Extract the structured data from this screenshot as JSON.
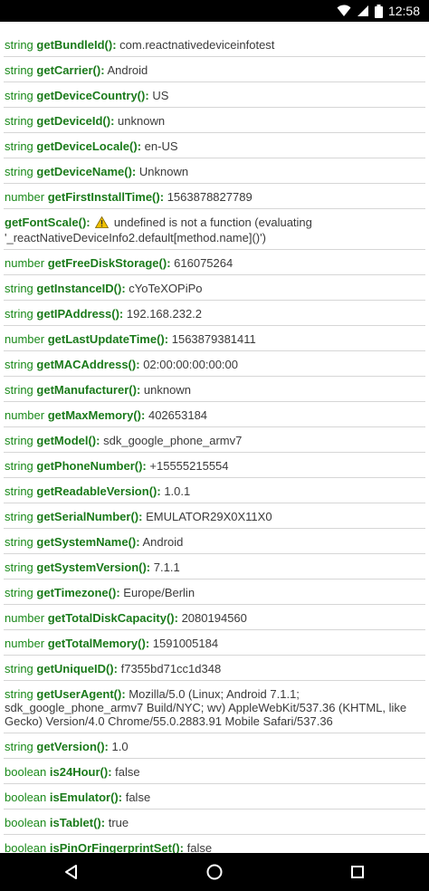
{
  "status_bar": {
    "time": "12:58",
    "icons": [
      "wifi-icon",
      "signal-icon",
      "battery-icon"
    ]
  },
  "rows": [
    {
      "type": "string",
      "method": "getBundleId()",
      "value": "com.reactnativedeviceinfotest"
    },
    {
      "type": "string",
      "method": "getCarrier()",
      "value": "Android"
    },
    {
      "type": "string",
      "method": "getDeviceCountry()",
      "value": "US"
    },
    {
      "type": "string",
      "method": "getDeviceId()",
      "value": "unknown"
    },
    {
      "type": "string",
      "method": "getDeviceLocale()",
      "value": "en-US"
    },
    {
      "type": "string",
      "method": "getDeviceName()",
      "value": "Unknown"
    },
    {
      "type": "number",
      "method": "getFirstInstallTime()",
      "value": "1563878827789"
    },
    {
      "type": "",
      "method": "getFontScale()",
      "warning": true,
      "value": "undefined is not a function (evaluating '_reactNativeDeviceInfo2.default[method.name]()')"
    },
    {
      "type": "number",
      "method": "getFreeDiskStorage()",
      "value": "616075264"
    },
    {
      "type": "string",
      "method": "getInstanceID()",
      "value": "cYoTeXOPiPo"
    },
    {
      "type": "string",
      "method": "getIPAddress()",
      "value": "192.168.232.2"
    },
    {
      "type": "number",
      "method": "getLastUpdateTime()",
      "value": "1563879381411"
    },
    {
      "type": "string",
      "method": "getMACAddress()",
      "value": "02:00:00:00:00:00"
    },
    {
      "type": "string",
      "method": "getManufacturer()",
      "value": "unknown"
    },
    {
      "type": "number",
      "method": "getMaxMemory()",
      "value": "402653184"
    },
    {
      "type": "string",
      "method": "getModel()",
      "value": "sdk_google_phone_armv7"
    },
    {
      "type": "string",
      "method": "getPhoneNumber()",
      "value": "+15555215554"
    },
    {
      "type": "string",
      "method": "getReadableVersion()",
      "value": "1.0.1"
    },
    {
      "type": "string",
      "method": "getSerialNumber()",
      "value": "EMULATOR29X0X11X0"
    },
    {
      "type": "string",
      "method": "getSystemName()",
      "value": "Android"
    },
    {
      "type": "string",
      "method": "getSystemVersion()",
      "value": "7.1.1"
    },
    {
      "type": "string",
      "method": "getTimezone()",
      "value": "Europe/Berlin"
    },
    {
      "type": "number",
      "method": "getTotalDiskCapacity()",
      "value": "2080194560"
    },
    {
      "type": "number",
      "method": "getTotalMemory()",
      "value": "1591005184"
    },
    {
      "type": "string",
      "method": "getUniqueID()",
      "value": "f7355bd71cc1d348"
    },
    {
      "type": "string",
      "method": "getUserAgent()",
      "value": "Mozilla/5.0 (Linux; Android 7.1.1; sdk_google_phone_armv7 Build/NYC; wv) AppleWebKit/537.36 (KHTML, like Gecko) Version/4.0 Chrome/55.0.2883.91 Mobile Safari/537.36"
    },
    {
      "type": "string",
      "method": "getVersion()",
      "value": "1.0"
    },
    {
      "type": "boolean",
      "method": "is24Hour()",
      "value": "false"
    },
    {
      "type": "boolean",
      "method": "isEmulator()",
      "value": "false"
    },
    {
      "type": "boolean",
      "method": "isTablet()",
      "value": "true"
    },
    {
      "type": "boolean",
      "method": "isPinOrFingerprintSet()",
      "value": "false"
    }
  ],
  "nav_bar": {
    "buttons": [
      "back-icon",
      "home-icon",
      "recents-icon"
    ]
  },
  "colors": {
    "type_green": "#1a8a1a",
    "value_text": "#3a3a3a",
    "divider": "#d6d6d6"
  }
}
